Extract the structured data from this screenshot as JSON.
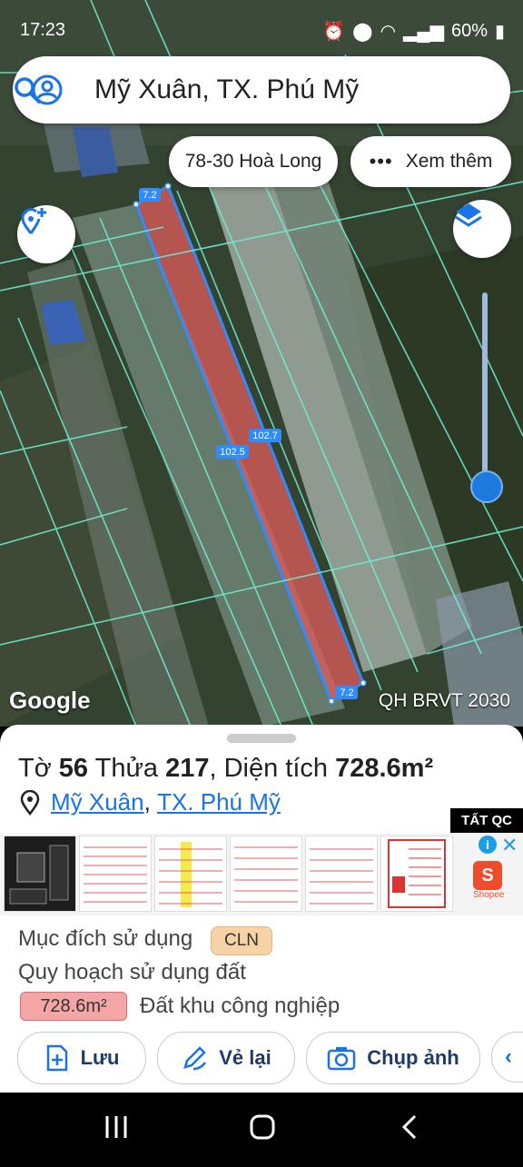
{
  "status_bar": {
    "time": "17:23",
    "battery": "60%"
  },
  "search": {
    "title": "Mỹ Xuân, TX. Phú Mỹ"
  },
  "chips": {
    "address": "78-30 Hoà Long",
    "more_label": "Xem thêm"
  },
  "map": {
    "measurements": {
      "top": "7.2",
      "left_side": "102.5",
      "right_side": "102.7",
      "bottom": "7.2"
    },
    "attribution": "Google",
    "layer_name": "QH BRVT 2030",
    "zoom_level_fraction": 0.05
  },
  "parcel": {
    "to_label": "Tờ",
    "to_value": "56",
    "thua_label": "Thửa",
    "thua_value": "217",
    "area_label": "Diện tích",
    "area_value": "728.6m²",
    "ward": "Mỹ Xuân",
    "town": "TX. Phú Mỹ",
    "purpose_label": "Mục đích sử dụng",
    "purpose_code": "CLN",
    "planning_label": "Quy hoạch sử dụng đất",
    "planning_area": "728.6m²",
    "planning_type": "Đất khu công nghiệp"
  },
  "ads": {
    "close_all": "TẤT QC",
    "shopee": "Shopee"
  },
  "actions": {
    "save": "Lưu",
    "redraw": "Vẻ lại",
    "capture": "Chụp ảnh"
  },
  "colors": {
    "accent": "#1a73e8",
    "parcel_fill": "#e05b5b",
    "purpose_badge": "#f6d2a7",
    "planning_badge": "#f4a6a6"
  }
}
